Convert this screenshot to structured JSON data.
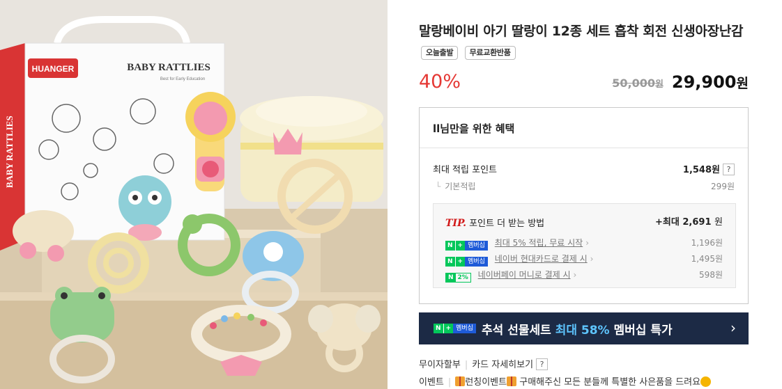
{
  "product_image": {
    "box_brand": "HUANGER",
    "box_title": "BABY RATTLIES",
    "box_subtitle": "Best for Early Education",
    "box_side": "BABY RATTLIES"
  },
  "product": {
    "title": "말랑베이비 아기 딸랑이 12종 세트 흡착 회전 신생아장난감",
    "badges": [
      "오늘출발",
      "무료교환반품"
    ]
  },
  "price": {
    "discount": "40%",
    "original": "50,000",
    "original_unit": "원",
    "sale": "29,900",
    "sale_unit": "원"
  },
  "benefits": {
    "heading": "ll님만을 위한 혜택",
    "max_points_label": "최대 적립 포인트",
    "max_points_value": "1,548원",
    "help": "?",
    "basic_label": "기본적립",
    "basic_value": "299원",
    "tip": {
      "label": "TIP.",
      "title": "포인트 더 받는 방법",
      "max_prefix": "+최대",
      "max_value": "2,691",
      "max_unit": "원",
      "items": [
        {
          "badge_n": "N",
          "badge_plus": "+",
          "badge_text": "멤버십",
          "link": "최대 5% 적립, 무료 시작",
          "amount": "1,196원"
        },
        {
          "badge_n": "N",
          "badge_plus": "+",
          "badge_text": "멤버십",
          "link": "네이버 현대카드로 결제 시",
          "amount": "1,495원"
        },
        {
          "badge_n": "N",
          "badge_text": "2%",
          "link": "네이버페이 머니로 결제 시",
          "amount": "598원"
        }
      ]
    }
  },
  "banner": {
    "badge_n": "N",
    "badge_plus": "+",
    "badge_text": "멤버십",
    "text_before": "추석 선물세트 ",
    "text_highlight": "최대 58%",
    "text_after": " 멤버십 특가",
    "arrow": "›"
  },
  "footer": {
    "installment": "무이자할부",
    "card_detail": "카드 자세히보기",
    "help": "?",
    "event_label": "이벤트",
    "event_text_1": "런칭이벤트",
    "event_text_2": "구매해주신 모든 분들께 특별한 사은품을 드려요"
  }
}
